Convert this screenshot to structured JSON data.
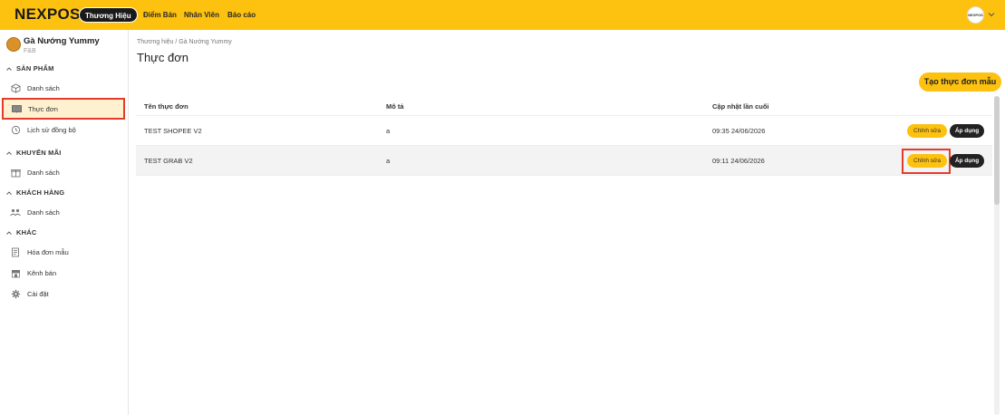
{
  "header": {
    "logo": "NEXPOS",
    "active_tab": "Thương Hiệu",
    "nav": [
      "Điểm Bán",
      "Nhân Viên",
      "Báo cáo"
    ],
    "avatar_text": "NEXPOS",
    "accent_color": "#FDC10F"
  },
  "store": {
    "name": "Gà Nướng Yummy",
    "type": "F&B"
  },
  "sidebar": {
    "sections": [
      {
        "title": "SẢN PHẨM",
        "items": [
          "Danh sách",
          "Thực đơn",
          "Lịch sử đồng bộ"
        ]
      },
      {
        "title": "KHUYẾN MÃI",
        "items": [
          "Danh sách"
        ]
      },
      {
        "title": "KHÁCH HÀNG",
        "items": [
          "Danh sách"
        ]
      },
      {
        "title": "KHÁC",
        "items": [
          "Hóa đơn mẫu",
          "Kênh bán",
          "Cài đặt"
        ]
      }
    ]
  },
  "main": {
    "breadcrumb": "Thương hiệu / Gà Nướng Yummy",
    "title": "Thực đơn",
    "create_button": "Tạo thực đơn mẫu",
    "columns": [
      "Tên thực đơn",
      "Mô tả",
      "Cập nhật lần cuối"
    ],
    "rows": [
      {
        "name": "TEST SHOPEE V2",
        "desc": "a",
        "updated": "09:35 24/06/2026",
        "edit": "Chỉnh sửa",
        "apply": "Áp dụng"
      },
      {
        "name": "TEST GRAB V2",
        "desc": "a",
        "updated": "09:11 24/06/2026",
        "edit": "Chỉnh sửa",
        "apply": "Áp dụng"
      }
    ]
  }
}
